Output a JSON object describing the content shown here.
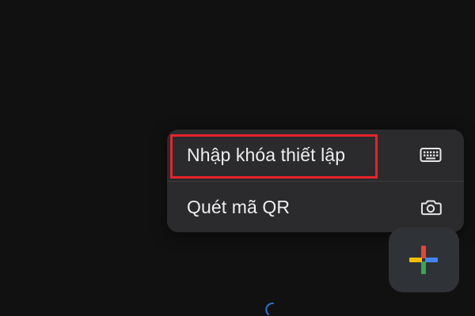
{
  "menu": {
    "items": [
      {
        "label": "Nhập khóa thiết lập",
        "icon": "keyboard-icon"
      },
      {
        "label": "Quét mã QR",
        "icon": "camera-icon"
      }
    ]
  },
  "fab": {
    "icon": "google-plus-icon"
  },
  "colors": {
    "highlight": "#e8222b",
    "menu_bg": "#2b2b2d",
    "fab_bg": "#2f3337",
    "google_red": "#ea4335",
    "google_blue": "#4285f4",
    "google_green": "#34a853",
    "google_yellow": "#fbbc05"
  }
}
